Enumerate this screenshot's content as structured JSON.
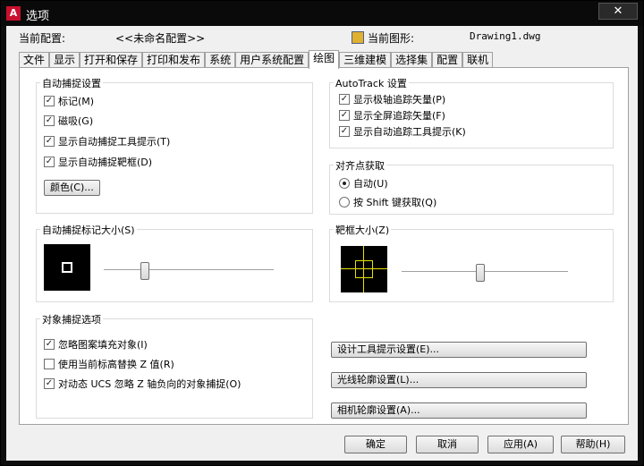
{
  "window": {
    "title": "选项",
    "close_label": "✕",
    "icon_text": "A"
  },
  "header": {
    "profile_label": "当前配置:",
    "profile_value": "<<未命名配置>>",
    "drawing_label": "当前图形:",
    "drawing_value": "Drawing1.dwg"
  },
  "tabs": [
    "文件",
    "显示",
    "打开和保存",
    "打印和发布",
    "系统",
    "用户系统配置",
    "绘图",
    "三维建模",
    "选择集",
    "配置",
    "联机"
  ],
  "autosnap": {
    "title": "自动捕捉设置",
    "items": [
      {
        "label": "标记(M)",
        "checked": true
      },
      {
        "label": "磁吸(G)",
        "checked": true
      },
      {
        "label": "显示自动捕捉工具提示(T)",
        "checked": true
      },
      {
        "label": "显示自动捕捉靶框(D)",
        "checked": true
      }
    ],
    "color_button": "颜色(C)..."
  },
  "autotrack": {
    "title": "AutoTrack 设置",
    "items": [
      {
        "label": "显示极轴追踪矢量(P)",
        "checked": true
      },
      {
        "label": "显示全屏追踪矢量(F)",
        "checked": true
      },
      {
        "label": "显示自动追踪工具提示(K)",
        "checked": true
      }
    ]
  },
  "alignment": {
    "title": "对齐点获取",
    "options": [
      {
        "label": "自动(U)",
        "selected": true
      },
      {
        "label": "按 Shift 键获取(Q)",
        "selected": false
      }
    ]
  },
  "marker_size": {
    "title": "自动捕捉标记大小(S)",
    "slider_fraction": 0.23
  },
  "aperture_size": {
    "title": "靶框大小(Z)",
    "slider_fraction": 0.47
  },
  "osnap": {
    "title": "对象捕捉选项",
    "items": [
      {
        "label": "忽略图案填充对象(I)",
        "checked": true
      },
      {
        "label": "使用当前标高替换 Z 值(R)",
        "checked": false
      },
      {
        "label": "对动态 UCS 忽略 Z 轴负向的对象捕捉(O)",
        "checked": true
      }
    ]
  },
  "right_buttons": [
    "设计工具提示设置(E)...",
    "光线轮廓设置(L)...",
    "相机轮廓设置(A)..."
  ],
  "bottom_buttons": [
    "确定",
    "取消",
    "应用(A)",
    "帮助(H)"
  ]
}
